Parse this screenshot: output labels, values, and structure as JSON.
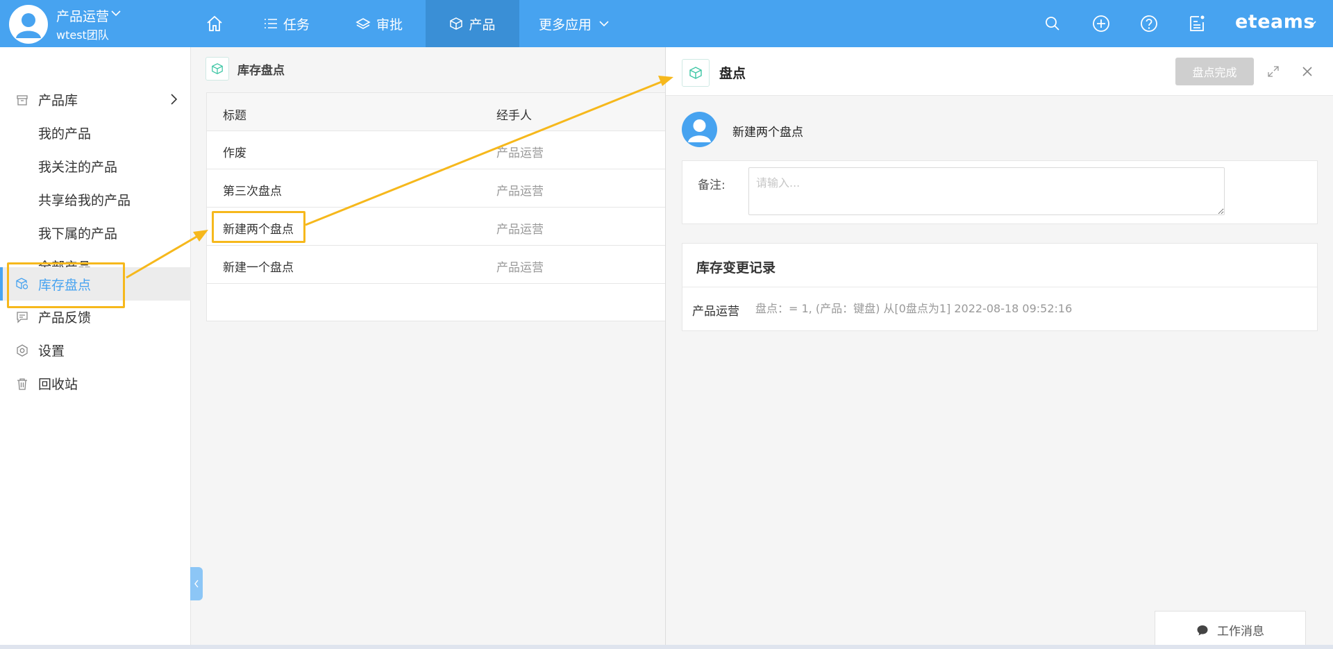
{
  "header": {
    "org_name": "产品运营",
    "team_name": "wtest团队",
    "nav": [
      {
        "label": "任务"
      },
      {
        "label": "审批"
      },
      {
        "label": "产品"
      },
      {
        "label": "更多应用"
      }
    ],
    "brand": "eteams"
  },
  "sidebar": {
    "items": [
      {
        "label": "产品库"
      },
      {
        "label": "我的产品"
      },
      {
        "label": "我关注的产品"
      },
      {
        "label": "共享给我的产品"
      },
      {
        "label": "我下属的产品"
      },
      {
        "label": "全部产品"
      },
      {
        "label": "库存盘点"
      },
      {
        "label": "产品反馈"
      },
      {
        "label": "设置"
      },
      {
        "label": "回收站"
      }
    ]
  },
  "list": {
    "title": "库存盘点",
    "columns": [
      "标题",
      "经手人"
    ],
    "rows": [
      {
        "title": "作废",
        "handler": "产品运营"
      },
      {
        "title": "第三次盘点",
        "handler": "产品运营"
      },
      {
        "title": "新建两个盘点",
        "handler": "产品运营"
      },
      {
        "title": "新建一个盘点",
        "handler": "产品运营"
      }
    ]
  },
  "detail": {
    "title": "盘点",
    "done_button": "盘点完成",
    "creator_title": "新建两个盘点",
    "note_label": "备注:",
    "note_placeholder": "请输入...",
    "log_title": "库存变更记录",
    "log_user": "产品运营",
    "log_text": "盘点：= 1, (产品：键盘) 从[0盘点为1] 2022-08-18 09:52:16"
  },
  "footer": {
    "message_button": "工作消息"
  },
  "colors": {
    "primary": "#47a3f0",
    "highlight": "#f6b81c"
  }
}
